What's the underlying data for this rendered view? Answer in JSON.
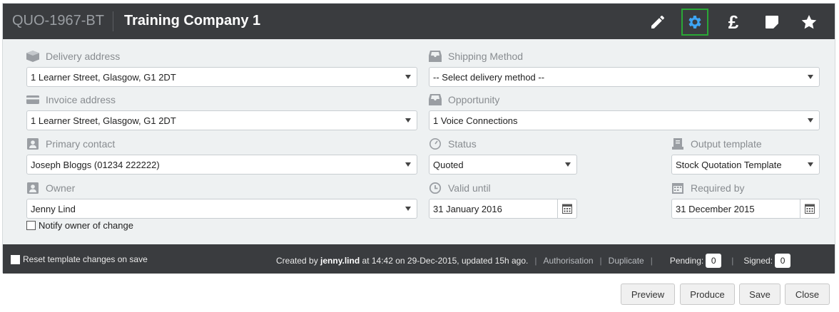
{
  "header": {
    "reference": "QUO-1967-BT",
    "company": "Training Company 1",
    "icons": [
      "pencil-icon",
      "gear-icon",
      "pound-icon",
      "note-icon",
      "star-icon"
    ],
    "pound_symbol": "£",
    "active_icon_color": "#2aa836"
  },
  "fields": {
    "delivery_address": {
      "label": "Delivery address",
      "value": "1 Learner Street, Glasgow, G1 2DT"
    },
    "shipping_method": {
      "label": "Shipping Method",
      "value": "-- Select delivery method --"
    },
    "invoice_address": {
      "label": "Invoice address",
      "value": "1 Learner Street, Glasgow, G1 2DT"
    },
    "opportunity": {
      "label": "Opportunity",
      "value": "1 Voice Connections"
    },
    "primary_contact": {
      "label": "Primary contact",
      "value": "Joseph Bloggs (01234 222222)"
    },
    "status": {
      "label": "Status",
      "value": "Quoted"
    },
    "output_template": {
      "label": "Output template",
      "value": "Stock Quotation Template"
    },
    "owner": {
      "label": "Owner",
      "value": "Jenny Lind"
    },
    "valid_until": {
      "label": "Valid until",
      "value": "31 January 2016"
    },
    "required_by": {
      "label": "Required by",
      "value": "31 December 2015"
    },
    "notify_owner": {
      "label": "Notify owner of change",
      "checked": false
    }
  },
  "footer": {
    "reset_template": {
      "label": "Reset template changes on save",
      "checked": false
    },
    "created_prefix": "Created by",
    "created_user": "jenny.lind",
    "created_suffix": "at 14:42 on 29-Dec-2015, updated 15h ago.",
    "authorisation_link": "Authorisation",
    "duplicate_link": "Duplicate",
    "pending_label": "Pending:",
    "pending_count": "0",
    "signed_label": "Signed:",
    "signed_count": "0"
  },
  "buttons": {
    "preview": "Preview",
    "produce": "Produce",
    "save": "Save",
    "close": "Close"
  }
}
